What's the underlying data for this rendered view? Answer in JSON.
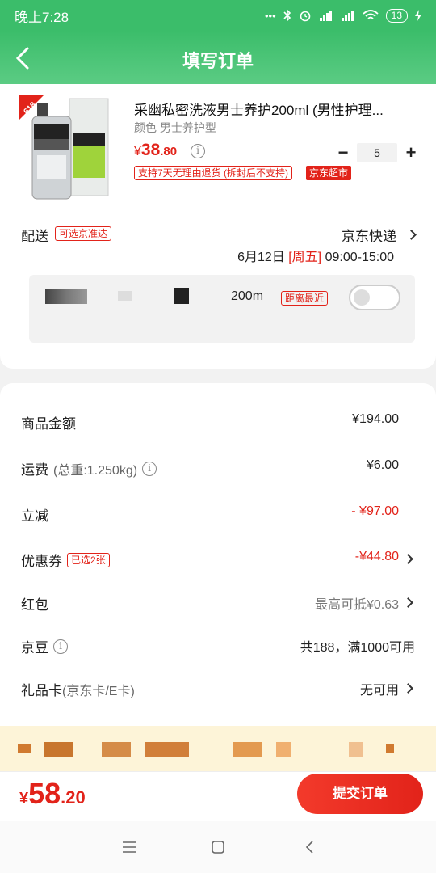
{
  "status_bar": {
    "time": "晚上7:28",
    "battery": "13"
  },
  "header": {
    "title": "填写订单"
  },
  "product": {
    "badge": "618",
    "title": "采幽私密洗液男士养护200ml (男性护理...",
    "spec": "颜色 男士养护型",
    "price_symbol": "¥",
    "price_int": "38",
    "price_dec": ".80",
    "quantity": "5",
    "return_tag": "支持7天无理由退货 (拆封后不支持)",
    "store_tag": "京东超市"
  },
  "delivery": {
    "label": "配送",
    "tag": "可选京准达",
    "method": "京东快递",
    "date": "6月12日",
    "weekday": "[周五]",
    "time": "09:00-15:00"
  },
  "address": {
    "text": "200m",
    "tag": "距离最近"
  },
  "summary": {
    "goods_label": "商品金额",
    "goods_value": "¥194.00",
    "freight_label": "运费",
    "freight_sub": "(总重:1.250kg)",
    "freight_value": "¥6.00",
    "discount_label": "立减",
    "discount_value": "- ¥97.00",
    "coupon_label": "优惠券",
    "coupon_tag": "已选2张",
    "coupon_value": "-¥44.80",
    "redpack_label": "红包",
    "redpack_value": "最高可抵¥0.63",
    "jingdou_label": "京豆",
    "jingdou_value": "共188，满1000可用",
    "giftcard_label": "礼品卡",
    "giftcard_sub": "(京东卡/E卡)",
    "giftcard_value": "无可用"
  },
  "footer": {
    "total_symbol": "¥",
    "total_int": "58",
    "total_dec": ".20",
    "submit_label": "提交订单"
  },
  "icons": [
    "back-arrow-icon",
    "info-icon",
    "chevron-right-icon",
    "menu-icon",
    "home-icon",
    "back-icon"
  ],
  "colors": {
    "brand_green": "#3bbd6a",
    "accent_red": "#e2231a"
  }
}
